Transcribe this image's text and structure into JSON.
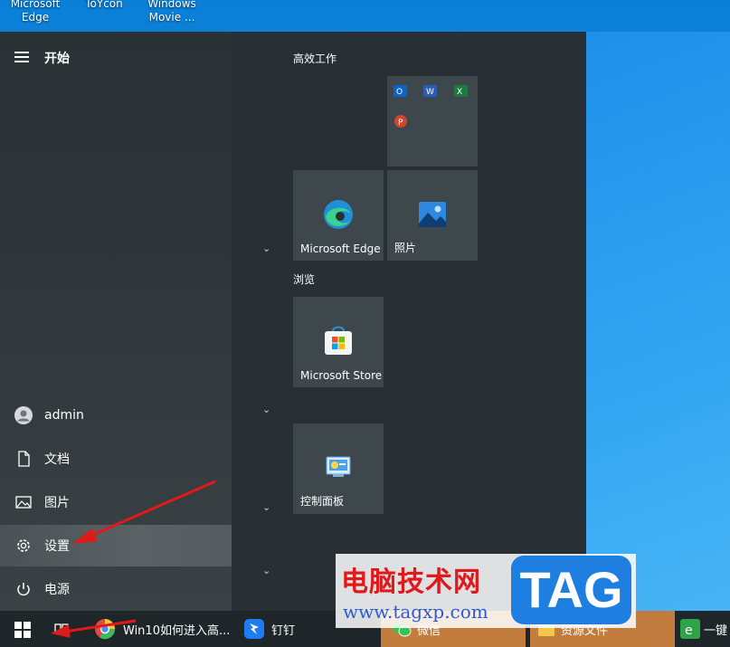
{
  "desktop": {
    "icons": [
      {
        "label_line1": "Microsoft",
        "label_line2": "Edge"
      },
      {
        "label_line1": "ToYcon",
        "label_line2": ""
      },
      {
        "label_line1": "Windows",
        "label_line2": "Movie ..."
      }
    ]
  },
  "start": {
    "title": "开始",
    "left_items": [
      {
        "label": "admin",
        "icon": "user-icon"
      },
      {
        "label": "文档",
        "icon": "document-icon"
      },
      {
        "label": "图片",
        "icon": "picture-icon"
      },
      {
        "label": "设置",
        "icon": "gear-icon"
      },
      {
        "label": "电源",
        "icon": "power-icon"
      }
    ],
    "groups": [
      {
        "label": "高效工作"
      },
      {
        "label": "浏览"
      }
    ],
    "tiles": {
      "edge": "Microsoft Edge",
      "photos": "照片",
      "store": "Microsoft Store",
      "control_panel": "控制面板"
    }
  },
  "taskbar": {
    "items": [
      {
        "label": "Win10如何进入高..."
      },
      {
        "label": "钉钉"
      },
      {
        "label": "微信"
      },
      {
        "label": "资源文件"
      },
      {
        "label": "一键"
      }
    ]
  },
  "watermark": {
    "title": "电脑技术网",
    "url": "www.tagxp.com",
    "tag": "TAG"
  },
  "colors": {
    "accent": "#1e7fe0",
    "arrow": "#e0191b"
  }
}
